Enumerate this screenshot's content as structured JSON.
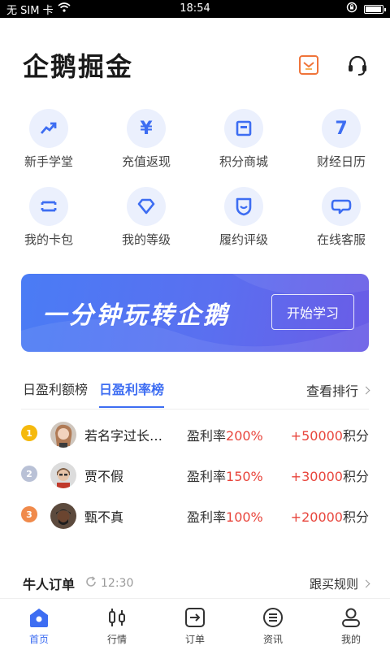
{
  "status_bar": {
    "carrier": "无 SIM 卡",
    "time": "18:54"
  },
  "header": {
    "title": "企鹅掘金",
    "icons": [
      "mail-icon",
      "headset-icon"
    ]
  },
  "features": [
    {
      "label": "新手学堂",
      "icon": "trend-up-icon",
      "glyph": ""
    },
    {
      "label": "充值返现",
      "icon": "yen-icon",
      "glyph": "¥"
    },
    {
      "label": "积分商城",
      "icon": "store-icon",
      "glyph": ""
    },
    {
      "label": "财经日历",
      "icon": "calendar-icon",
      "glyph": "7"
    },
    {
      "label": "我的卡包",
      "icon": "card-wallet-icon",
      "glyph": ""
    },
    {
      "label": "我的等级",
      "icon": "diamond-icon",
      "glyph": ""
    },
    {
      "label": "履约评级",
      "icon": "shield-icon",
      "glyph": ""
    },
    {
      "label": "在线客服",
      "icon": "chat-bubble-icon",
      "glyph": ""
    }
  ],
  "banner": {
    "text": "一分钟玩转企鹅",
    "button": "开始学习"
  },
  "ranking": {
    "tabs": [
      "日盈利额榜",
      "日盈利率榜"
    ],
    "active_tab": 1,
    "view_all": "查看排行",
    "rows": [
      {
        "rank": "1",
        "name": "若名字过长…",
        "rate_label": "盈利率",
        "rate": "200%",
        "points": "+50000",
        "points_unit": "积分",
        "medal_color": "#f5b90d"
      },
      {
        "rank": "2",
        "name": "贾不假",
        "rate_label": "盈利率",
        "rate": "150%",
        "points": "+30000",
        "points_unit": "积分",
        "medal_color": "#b9c1d6"
      },
      {
        "rank": "3",
        "name": "甄不真",
        "rate_label": "盈利率",
        "rate": "100%",
        "points": "+20000",
        "points_unit": "积分",
        "medal_color": "#f08a4b"
      }
    ]
  },
  "orders": {
    "title": "牛人订单",
    "time": "12:30",
    "rules": "跟买规则"
  },
  "bottom_nav": [
    {
      "label": "首页",
      "icon": "home-icon",
      "active": true
    },
    {
      "label": "行情",
      "icon": "candlestick-icon",
      "active": false
    },
    {
      "label": "订单",
      "icon": "order-icon",
      "active": false
    },
    {
      "label": "资讯",
      "icon": "news-icon",
      "active": false
    },
    {
      "label": "我的",
      "icon": "profile-icon",
      "active": false
    }
  ],
  "colors": {
    "accent": "#3d6df2",
    "highlight": "#e8453c",
    "icon_bg": "#ebf0fd"
  }
}
